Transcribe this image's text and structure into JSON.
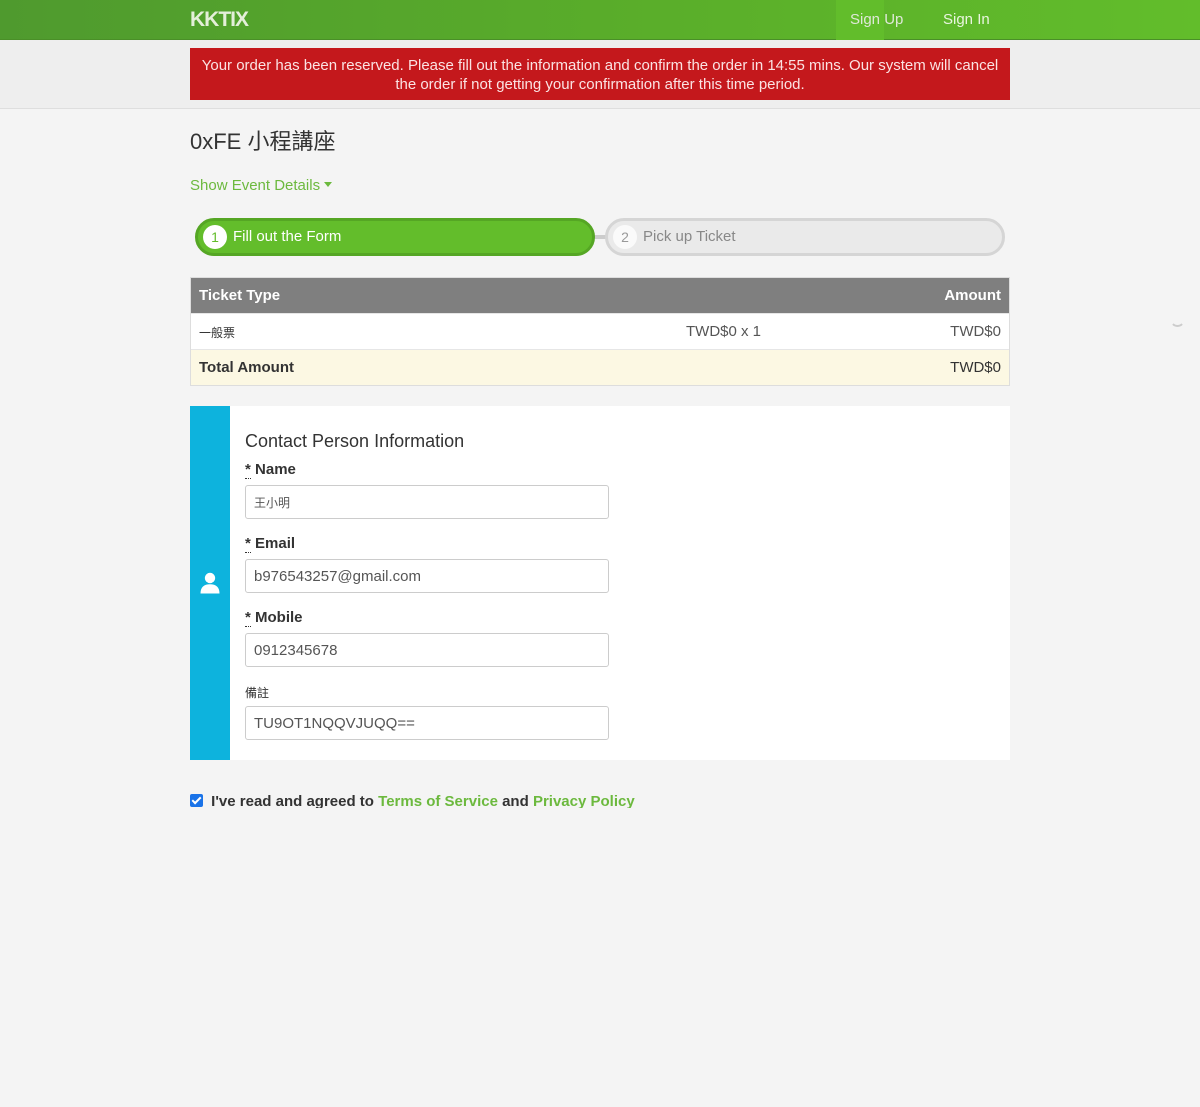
{
  "header": {
    "logo_text": "KKTIX",
    "nav": {
      "sign_up": "Sign Up",
      "sign_in": "Sign In"
    }
  },
  "alert": {
    "message": "Your order has been reserved. Please fill out the information and confirm the order in 14:55 mins. Our system will cancel the order if not getting your confirmation after this time period."
  },
  "event": {
    "title": "0xFE 小程講座",
    "show_details": "Show Event Details"
  },
  "steps": [
    {
      "number": "1",
      "label": "Fill out the Form",
      "active": true
    },
    {
      "number": "2",
      "label": "Pick up Ticket",
      "active": false
    }
  ],
  "ticket_table": {
    "headers": {
      "type": "Ticket Type",
      "amount": "Amount"
    },
    "rows": [
      {
        "type": "一般票",
        "price_qty": "TWD$0 x 1",
        "amount": "TWD$0"
      }
    ],
    "total": {
      "label": "Total Amount",
      "amount": "TWD$0"
    }
  },
  "contact": {
    "title": "Contact Person Information",
    "icon": "user-icon",
    "fields": [
      {
        "required": "*",
        "label": "Name",
        "value": "王小明"
      },
      {
        "required": "*",
        "label": "Email",
        "value": "b976543257@gmail.com"
      },
      {
        "required": "*",
        "label": "Mobile",
        "value": "0912345678"
      },
      {
        "required": "",
        "label": "備註",
        "value": "TU9OT1NQQVJUQQ=="
      }
    ]
  },
  "agreement": {
    "checked": true,
    "prefix": "I've read and agreed to",
    "terms_link": "Terms of Service",
    "and": "and",
    "privacy_link": "Privacy Policy"
  },
  "colors": {
    "brand_green": "#62bd2b",
    "alert_red": "#c4181c",
    "contact_strip": "#0db3dd",
    "link_green": "#6cb93e"
  }
}
